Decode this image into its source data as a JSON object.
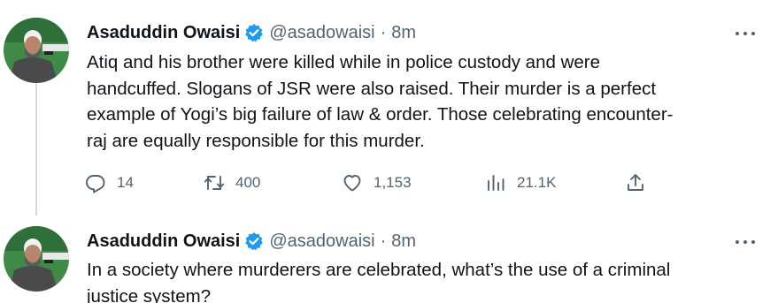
{
  "tweets": [
    {
      "author": "Asaduddin Owaisi",
      "handle": "@asadowaisi",
      "separator": "·",
      "time": "8m",
      "lines": [
        "Atiq and his brother were killed while in police custody and were",
        "handcuffed. Slogans of JSR were also raised. Their murder is a perfect",
        "example of Yogi’s big failure of law & order. Those celebrating encounter-",
        "raj are equally responsible for this murder."
      ],
      "replies": "14",
      "retweets": "400",
      "likes": "1,153",
      "views": "21.1K"
    },
    {
      "author": "Asaduddin Owaisi",
      "handle": "@asadowaisi",
      "separator": "·",
      "time": "8m",
      "lines": [
        "In a society where murderers are celebrated, what’s the use of a criminal",
        "justice system?"
      ]
    }
  ],
  "icons": {
    "verified": "verified-badge-icon",
    "more": "more-options-icon",
    "reply": "reply-icon",
    "retweet": "retweet-icon",
    "like": "heart-icon",
    "views": "views-icon",
    "share": "share-icon"
  },
  "colors": {
    "verified": "#1d9bf0",
    "secondary_text": "#536471",
    "primary_text": "#0f1419",
    "thread_line": "#cfd9de"
  }
}
